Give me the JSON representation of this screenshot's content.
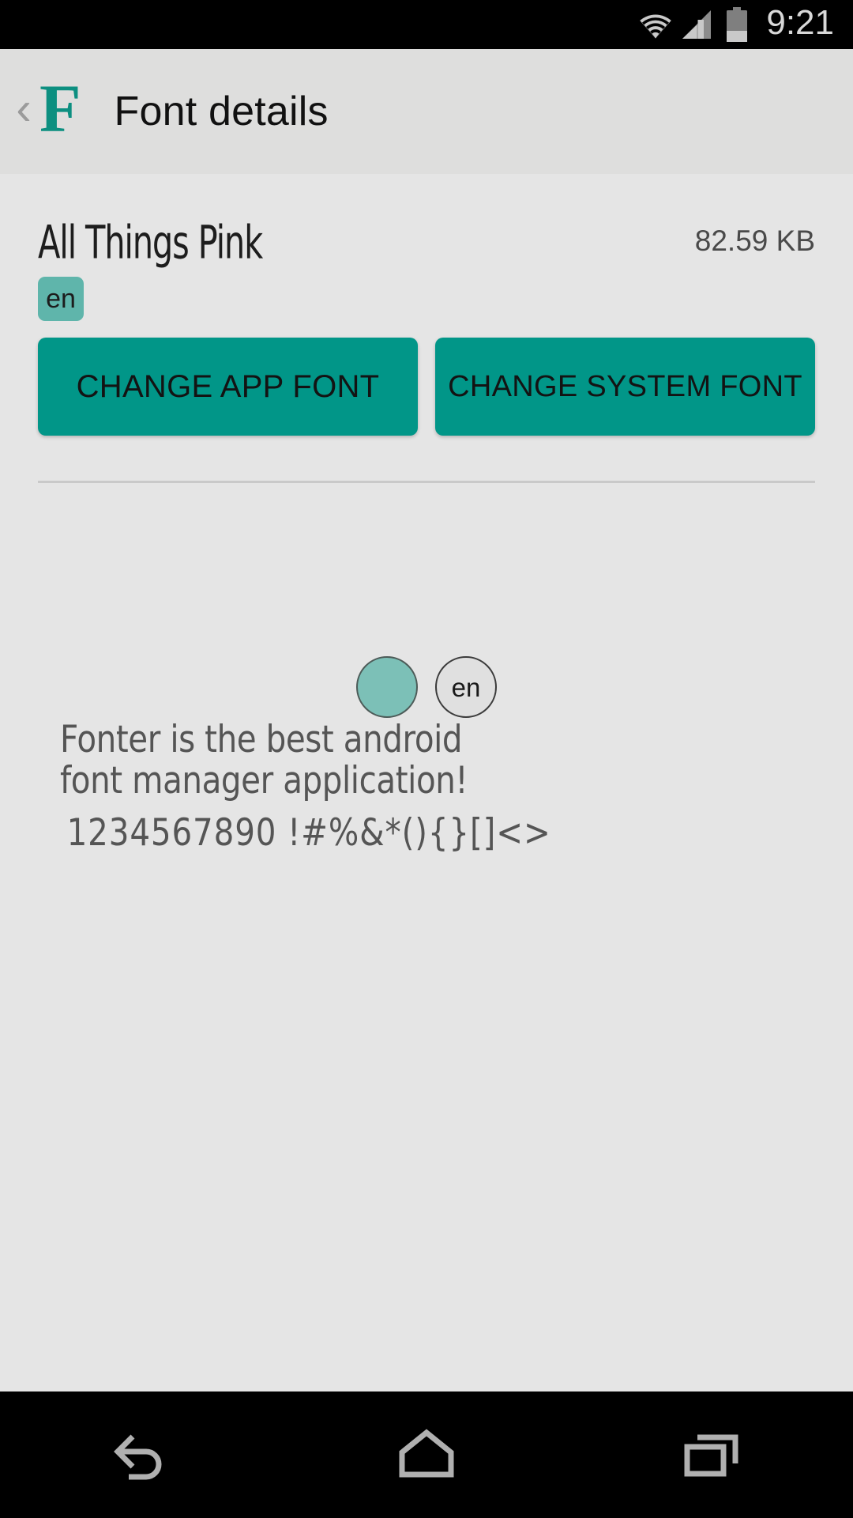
{
  "status_bar": {
    "clock": "9:21",
    "icons": [
      {
        "name": "wifi-icon",
        "label": "wifi"
      },
      {
        "name": "cellular-signal-icon",
        "label": "signal"
      },
      {
        "name": "battery-icon",
        "label": "battery"
      }
    ]
  },
  "action_bar": {
    "back_label": "‹",
    "logo_letter": "F",
    "title": "Font details",
    "accent_color": "#0c8f80",
    "background_color": "#dededd"
  },
  "font_details": {
    "name": "All Things Pink",
    "size": "82.59 KB",
    "language_badges": [
      {
        "label": "en",
        "color": "#5fb5ab"
      }
    ],
    "actions": [
      {
        "id": "change-app-font",
        "label": "CHANGE APP FONT"
      },
      {
        "id": "change-system-font",
        "label": "CHANGE SYSTEM FONT"
      }
    ],
    "action_color": "#019688"
  },
  "preview": {
    "chips": [
      {
        "id": "chip-selected",
        "label": "",
        "selected": true,
        "color": "#7cc0b7"
      },
      {
        "id": "chip-en",
        "label": "en",
        "selected": false,
        "color": "#e0e0e0"
      }
    ],
    "sample_line_1": "Fonter is the best android font manager application!",
    "sample_line_2": "1234567890 !#%&*(){}[]<>"
  },
  "nav_bar": {
    "buttons": [
      {
        "name": "nav-back-button",
        "label": "back"
      },
      {
        "name": "nav-home-button",
        "label": "home"
      },
      {
        "name": "nav-recents-button",
        "label": "recents"
      }
    ]
  },
  "theme": {
    "background": "#e5e5e5",
    "teal_primary": "#019688",
    "teal_light": "#5fb5ab",
    "text_primary": "#1d1d1d",
    "text_secondary": "#555555"
  }
}
